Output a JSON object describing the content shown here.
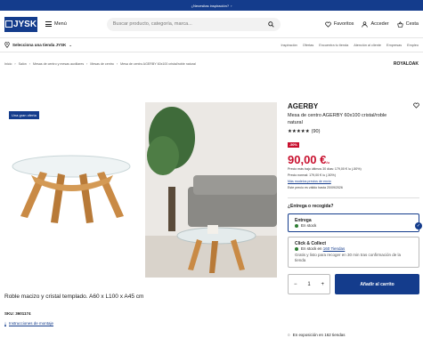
{
  "topbar": {
    "text": "¿Necesitas inspiración?",
    "arrow": "›"
  },
  "header": {
    "logo": "JYSK",
    "menu_label": "Menú",
    "search_placeholder": "Buscar producto, categoría, marca...",
    "favorites": "Favoritos",
    "login": "Acceder",
    "cart": "Cesta"
  },
  "storebar": {
    "store_label": "Selecciona una tienda JYSK",
    "links": [
      "Inspiración",
      "Ofertas",
      "Encuentra tu tienda",
      "Atención al cliente",
      "Empresas",
      "Empleo"
    ]
  },
  "breadcrumbs": [
    "Inicio",
    "Salón",
    "Mesas de centro y mesas auxiliares",
    "Mesas de centro",
    "Mesa de centro AGERBY 60x100 cristal/roble natural"
  ],
  "brand_logo": "ROYALOAK",
  "gallery": {
    "badge": "Una gran oferta"
  },
  "product": {
    "name": "AGERBY",
    "subtitle": "Mesa de centro AGERBY 60x100 cristal/roble natural",
    "stars": "★★★★★",
    "reviews": "(90)",
    "discount": "-50%",
    "price": "90,00 €",
    "price_unit": "/u",
    "lowest_price_note": "Precio más bajo últimos 30 días: 179,00 € /u (-50%)",
    "normal_price_note": "Precio normal: 179,00 € /u (-50%)",
    "more_models": "Más modelos previos de envío",
    "valid_until": "Este precio es válido hasta 20/09/2026",
    "description": "Roble macizo y cristal templado. A60 x L100 x A45 cm",
    "sku": "SKU: 3601174",
    "instructions": "Instrucciones de montaje"
  },
  "delivery": {
    "question": "¿Entrega o recogida?",
    "option1_title": "Entrega",
    "option1_status": "En stock",
    "option2_title": "Click & Collect",
    "option2_status_prefix": "En stock en ",
    "option2_status_link": "160 Tiendas",
    "option2_note": "Gratis y listo para recoger en 30 min tras confirmación de la tienda"
  },
  "cart": {
    "minus": "−",
    "qty": "1",
    "plus": "+",
    "add_label": "Añadir al carrito"
  },
  "exposition": "En exposición en 162 tiendas",
  "colors": {
    "brand_blue": "#143c8c",
    "sale_red": "#c8102e",
    "stock_green": "#2e7d32"
  }
}
